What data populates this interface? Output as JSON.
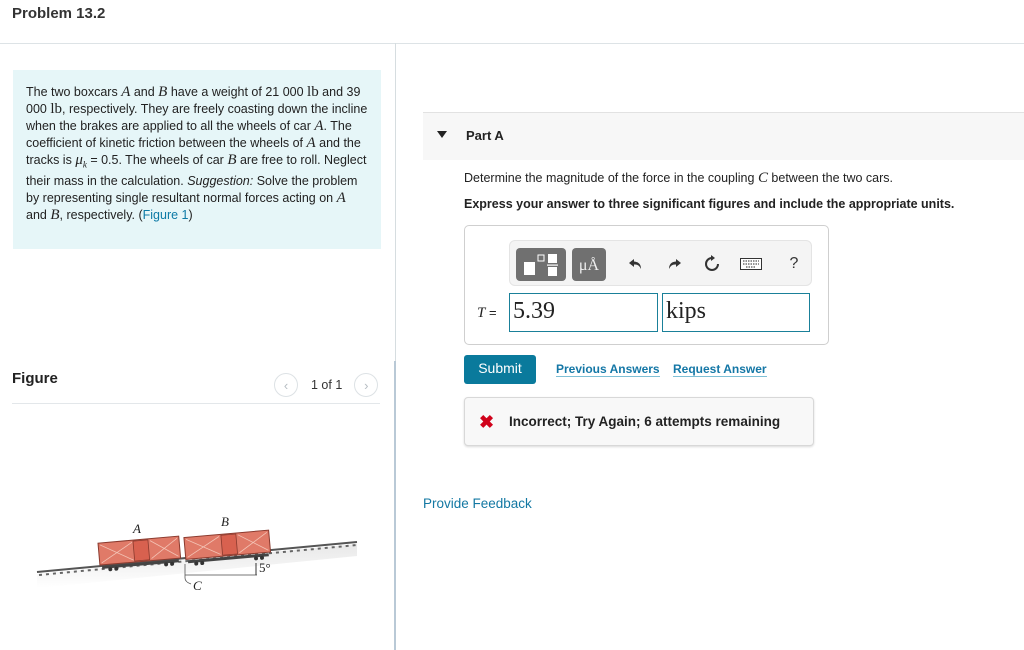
{
  "page": {
    "title": "Problem 13.2"
  },
  "problem": {
    "segments": [
      {
        "t": "text",
        "v": "The two boxcars "
      },
      {
        "t": "math",
        "v": "A"
      },
      {
        "t": "text",
        "v": " and "
      },
      {
        "t": "math",
        "v": "B"
      },
      {
        "t": "text",
        "v": " have a weight of 21 000 "
      },
      {
        "t": "unit",
        "v": "lb"
      },
      {
        "t": "text",
        "v": " and 39 000 "
      },
      {
        "t": "unit",
        "v": "lb"
      },
      {
        "t": "text",
        "v": ", respectively. They are freely coasting down the incline when the brakes are applied to all the wheels of car "
      },
      {
        "t": "math",
        "v": "A"
      },
      {
        "t": "text",
        "v": ". The coefficient of kinetic friction between the wheels of "
      },
      {
        "t": "math",
        "v": "A"
      },
      {
        "t": "text",
        "v": " and the tracks is "
      },
      {
        "t": "math",
        "v": "μ"
      },
      {
        "t": "sub",
        "v": "k"
      },
      {
        "t": "text",
        "v": " = 0.5. The wheels of car "
      },
      {
        "t": "math",
        "v": "B"
      },
      {
        "t": "text",
        "v": " are free to roll. Neglect their mass in the calculation. "
      },
      {
        "t": "em",
        "v": "Suggestion:"
      },
      {
        "t": "text",
        "v": " Solve the problem by representing single resultant normal forces acting on "
      },
      {
        "t": "math",
        "v": "A"
      },
      {
        "t": "text",
        "v": " and "
      },
      {
        "t": "math",
        "v": "B"
      },
      {
        "t": "text",
        "v": ", respectively. ("
      },
      {
        "t": "link",
        "v": "Figure 1"
      },
      {
        "t": "text",
        "v": ")"
      }
    ]
  },
  "figure": {
    "heading": "Figure",
    "pager": "1 of 1",
    "prev_icon": "chevron-left-icon",
    "next_icon": "chevron-right-icon",
    "labels": {
      "car_a": "A",
      "car_b": "B",
      "coupling": "C",
      "angle": "5°"
    },
    "colors": {
      "boxcar": "#e07a68",
      "track": "#555555"
    }
  },
  "part": {
    "title": "Part A",
    "question_before": "Determine the magnitude of the force in the coupling ",
    "question_math": "C",
    "question_after": " between the two cars.",
    "instruction": "Express your answer to three significant figures and include the appropriate units."
  },
  "answer": {
    "toolbar": {
      "templates_icon": "templates-icon",
      "units_label": "μÅ",
      "undo_icon": "undo-icon",
      "redo_icon": "redo-icon",
      "reset_icon": "reset-icon",
      "keyboard_icon": "keyboard-icon",
      "help_label": "?"
    },
    "variable": "T",
    "equals": " = ",
    "value": "5.39",
    "units": "kips"
  },
  "actions": {
    "submit": "Submit",
    "previous_answers": "Previous Answers",
    "request_answer": "Request Answer"
  },
  "feedback": {
    "icon": "✖",
    "message": "Incorrect; Try Again; 6 attempts remaining",
    "attempts_remaining": 6,
    "status_color": "#d0021b"
  },
  "footer": {
    "provide_feedback": "Provide Feedback"
  },
  "colors": {
    "accent": "#0a7a9c",
    "link": "#1477a6",
    "problem_bg": "#e6f6f8"
  }
}
